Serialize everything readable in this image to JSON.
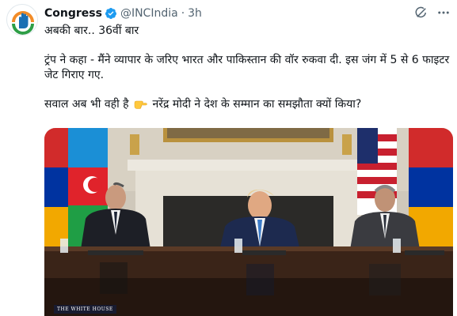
{
  "author": {
    "name": "Congress",
    "handle": "@INCIndia",
    "separator": "·",
    "time": "3h",
    "verified": true
  },
  "icons": {
    "avatar": "congress-hand-logo",
    "verified": "verified-badge-icon",
    "grok": "grok-icon",
    "more": "more-options-icon",
    "pointing": "backhand-index-pointing-right-emoji"
  },
  "tweet": {
    "line1": "अबकी बार.. 36वीं बार",
    "line2": "ट्रंप ने कहा - मैंने व्यापार के जरिए भारत और पाकिस्तान की वॉर रुकवा दी. इस जंग में 5 से 6 फाइटर जेट गिराए गए.",
    "line3a": "सवाल अब भी वही है",
    "line3b": "नरेंद्र मोदी ने देश के सम्मान का समझौता क्यों किया?"
  },
  "media": {
    "watermark": "THE WHITE HOUSE"
  },
  "colors": {
    "verified": "#1d9bf0",
    "secondary_text": "#536471",
    "avatar_orange": "#f28c28",
    "avatar_green": "#2e9e46"
  }
}
